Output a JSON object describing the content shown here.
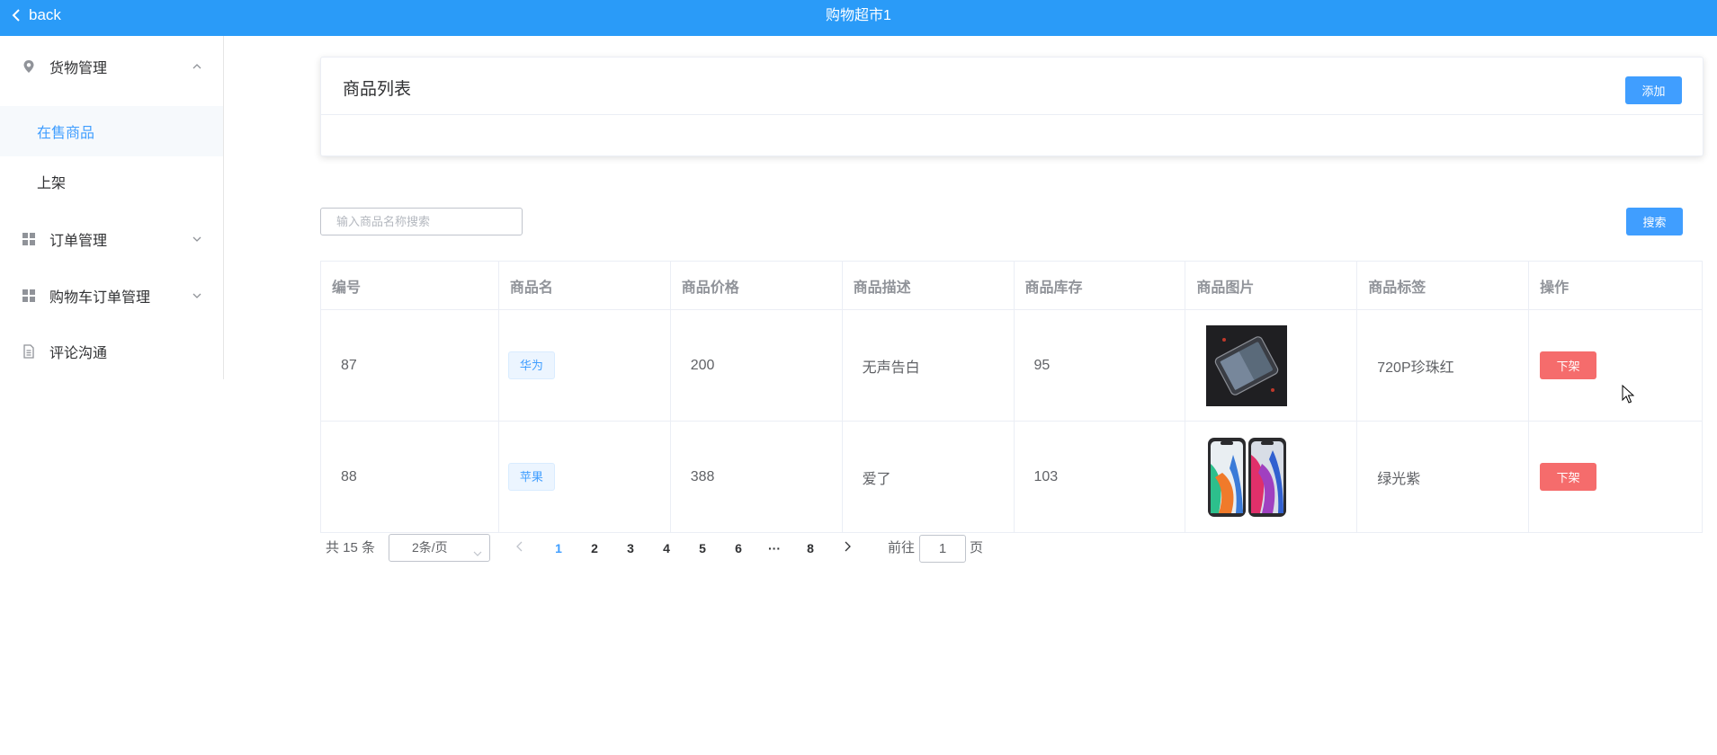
{
  "topbar": {
    "back_label": "back",
    "title": "购物超市1",
    "color": "#2a9bf8"
  },
  "sidebar": {
    "groups": [
      {
        "label": "货物管理",
        "icon": "location-pin-icon",
        "expanded": true,
        "items": [
          {
            "label": "在售商品",
            "active": true
          },
          {
            "label": "上架",
            "active": false
          }
        ]
      },
      {
        "label": "订单管理",
        "icon": "grid-icon",
        "expanded": false
      },
      {
        "label": "购物车订单管理",
        "icon": "grid-icon",
        "expanded": false
      },
      {
        "label": "评论沟通",
        "icon": "document-icon"
      }
    ],
    "active_color": "#409eff"
  },
  "card": {
    "title": "商品列表",
    "add_label": "添加"
  },
  "search": {
    "placeholder": "输入商品名称搜索",
    "button_label": "搜索"
  },
  "table": {
    "columns": [
      "编号",
      "商品名",
      "商品价格",
      "商品描述",
      "商品库存",
      "商品图片",
      "商品标签",
      "操作"
    ],
    "rows": [
      {
        "id": "87",
        "name": "华为",
        "price": "200",
        "desc": "无声告白",
        "stock": "95",
        "image": "dark-phone-photo",
        "label": "720P珍珠红",
        "action": "下架"
      },
      {
        "id": "88",
        "name": "苹果",
        "price": "388",
        "desc": "爱了",
        "stock": "103",
        "image": "two-phones-photo",
        "label": "绿光紫",
        "action": "下架"
      }
    ]
  },
  "pagination": {
    "total_text": "共 15 条",
    "page_size": "2条/页",
    "pages": [
      "1",
      "2",
      "3",
      "4",
      "5",
      "6",
      "···",
      "8"
    ],
    "current": "1",
    "goto_label": "前往",
    "goto_value": "1",
    "page_suffix": "页"
  },
  "colors": {
    "primary": "#409eff",
    "danger": "#f56c6c",
    "border": "#ebeef5"
  }
}
